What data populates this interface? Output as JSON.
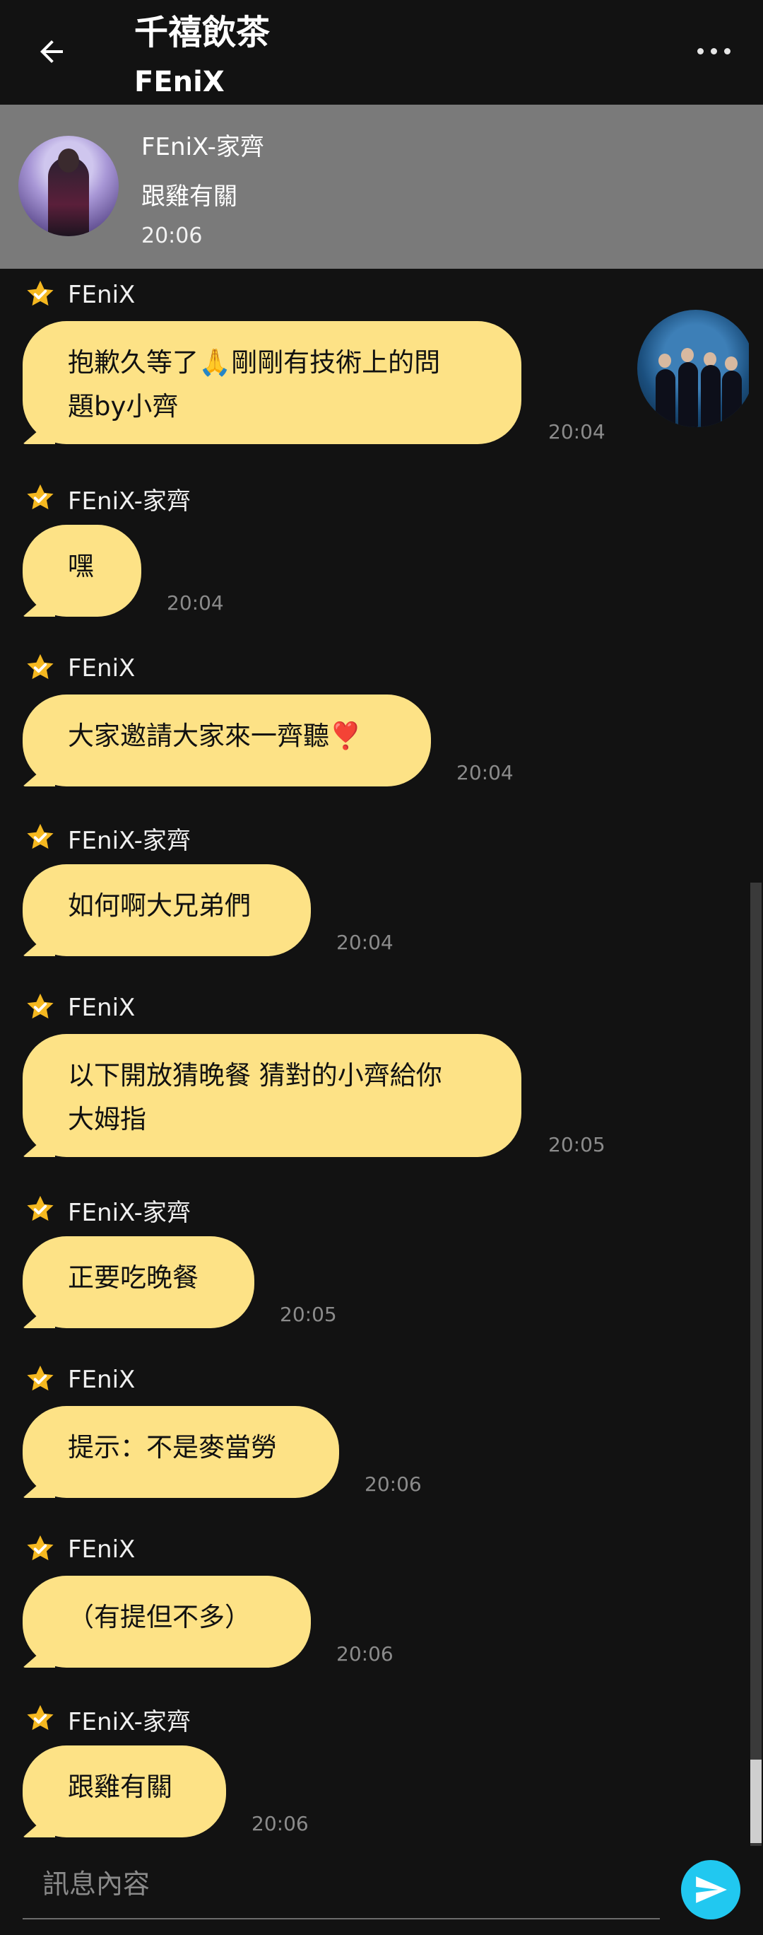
{
  "header": {
    "title": "千禧飲茶",
    "subtitle": "FEniX",
    "back_icon": "arrow-left-icon",
    "more_icon": "more-horizontal-icon"
  },
  "pinned": {
    "sender": "FEniX-家齊",
    "text": "跟雞有關",
    "time": "20:06"
  },
  "colors": {
    "bubble": "#fde286",
    "background": "#121212",
    "pinned_bg": "#7a7a7a",
    "badge": "#f5b820",
    "send": "#21c8f0"
  },
  "messages": [
    {
      "sender": "FEniX",
      "lines": [
        "抱歉久等了🙏剛剛有技術上的問",
        "題by小齊"
      ],
      "time": "20:04"
    },
    {
      "sender": "FEniX-家齊",
      "lines": [
        "嘿"
      ],
      "time": "20:04"
    },
    {
      "sender": "FEniX",
      "lines": [
        "大家邀請大家來一齊聽❣️"
      ],
      "time": "20:04"
    },
    {
      "sender": "FEniX-家齊",
      "lines": [
        "如何啊大兄弟們"
      ],
      "time": "20:04"
    },
    {
      "sender": "FEniX",
      "lines": [
        "以下開放猜晚餐 猜對的小齊給你",
        "大姆指"
      ],
      "time": "20:05"
    },
    {
      "sender": "FEniX-家齊",
      "lines": [
        "正要吃晚餐"
      ],
      "time": "20:05"
    },
    {
      "sender": "FEniX",
      "lines": [
        "提示：不是麥當勞"
      ],
      "time": "20:06"
    },
    {
      "sender": "FEniX",
      "lines": [
        "（有提但不多）"
      ],
      "time": "20:06"
    },
    {
      "sender": "FEniX-家齊",
      "lines": [
        "跟雞有關"
      ],
      "time": "20:06"
    }
  ],
  "input": {
    "placeholder": "訊息內容"
  }
}
